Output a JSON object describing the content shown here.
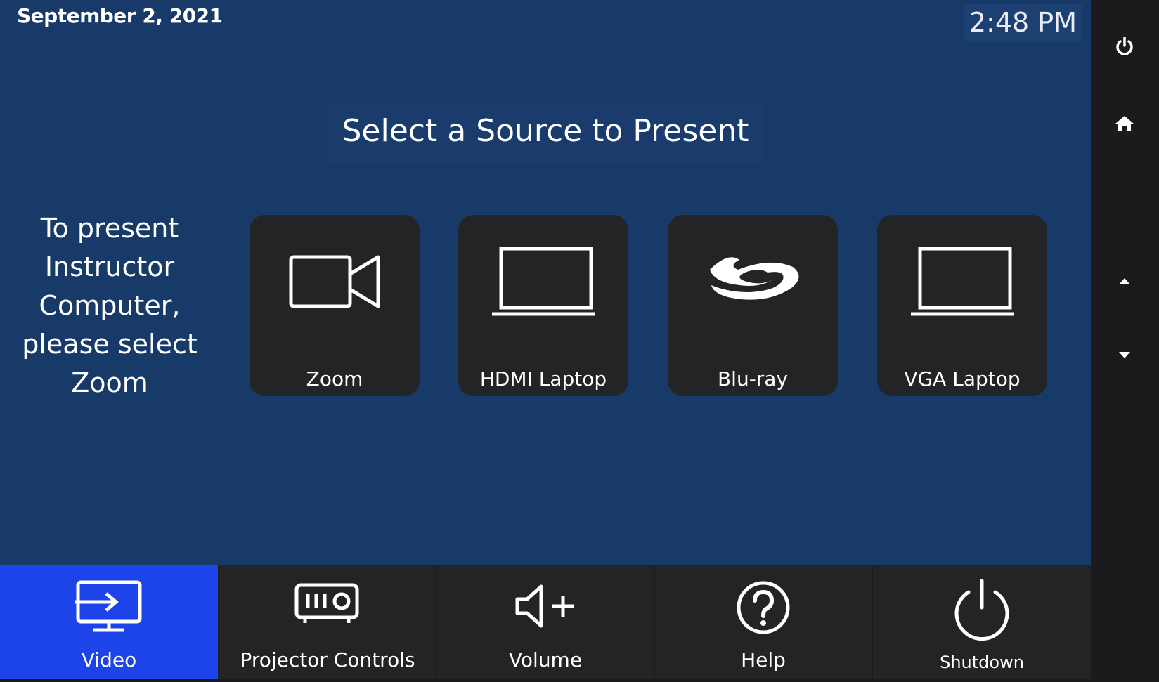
{
  "header": {
    "date": "September 2, 2021",
    "time": "2:48 PM"
  },
  "main": {
    "title": "Select a Source to Present",
    "hint": "To present Instructor Computer, please select Zoom"
  },
  "sources": [
    {
      "label": "Zoom",
      "icon": "video-camera-icon"
    },
    {
      "label": "HDMI Laptop",
      "icon": "laptop-icon"
    },
    {
      "label": "Blu-ray",
      "icon": "bluray-icon"
    },
    {
      "label": "VGA Laptop",
      "icon": "laptop-icon"
    }
  ],
  "sidebar": {
    "items": [
      {
        "icon": "power-icon"
      },
      {
        "icon": "home-icon"
      },
      {
        "icon": "arrow-up-icon"
      },
      {
        "icon": "arrow-down-icon"
      }
    ]
  },
  "bottom_nav": [
    {
      "label": "Video",
      "icon": "display-icon",
      "active": true
    },
    {
      "label": "Projector Controls",
      "icon": "projector-icon",
      "active": false
    },
    {
      "label": "Volume",
      "icon": "volume-up-icon",
      "active": false
    },
    {
      "label": "Help",
      "icon": "help-icon",
      "active": false
    },
    {
      "label": "Shutdown",
      "icon": "power-icon",
      "active": false
    }
  ],
  "colors": {
    "main_bg": "#173a68",
    "tile_bg": "#222426",
    "nav_active": "#1c44e8",
    "nav_bg": "#232426"
  }
}
